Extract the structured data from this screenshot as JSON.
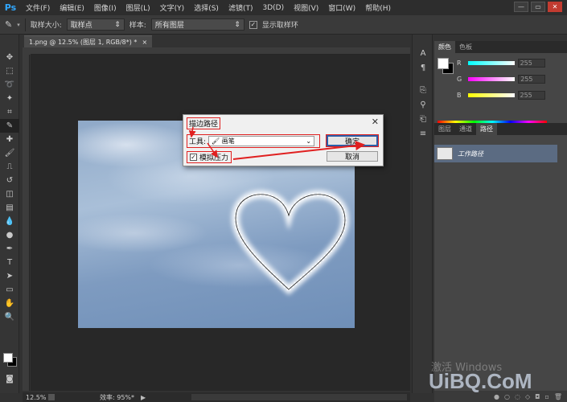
{
  "app": {
    "logo": "Ps",
    "menu": [
      "文件(F)",
      "编辑(E)",
      "图像(I)",
      "图层(L)",
      "文字(Y)",
      "选择(S)",
      "滤镜(T)",
      "3D(D)",
      "视图(V)",
      "窗口(W)",
      "帮助(H)"
    ],
    "window_controls": [
      "—",
      "▭",
      "✕"
    ]
  },
  "options": {
    "sample_size_label": "取样大小:",
    "sample_size_value": "取样点",
    "sample_label": "样本:",
    "sample_value": "所有图层",
    "show_ring_label": "显示取样环",
    "show_ring_checked": "✓"
  },
  "document": {
    "tab_title": "1.png @ 12.5% (图层 1, RGB/8*) *",
    "tab_close": "×"
  },
  "status": {
    "zoom": "12.5%",
    "efficiency": "效率: 95%*"
  },
  "dialog": {
    "title": "描边路径",
    "close": "✕",
    "tool_label": "工具:",
    "tool_value": "画笔",
    "simulate_pressure_label": "模拟压力",
    "simulate_pressure_checked": "✓",
    "ok": "确定",
    "cancel": "取消"
  },
  "color_panel": {
    "tabs": [
      "颜色",
      "色板"
    ],
    "rows": [
      {
        "label": "R",
        "value": "255",
        "color": "#00ffff"
      },
      {
        "label": "G",
        "value": "255",
        "color": "#ff00ff"
      },
      {
        "label": "B",
        "value": "255",
        "color": "#ffff00"
      }
    ]
  },
  "paths_panel": {
    "tabs": [
      "图层",
      "通道",
      "路径"
    ],
    "item_name": "工作路径"
  },
  "watermark": {
    "activate": "激活 Windows",
    "site": "UiBQ.CoM"
  },
  "colors": {
    "annotation_red": "#e02020",
    "ps_blue": "#31a8ff"
  }
}
